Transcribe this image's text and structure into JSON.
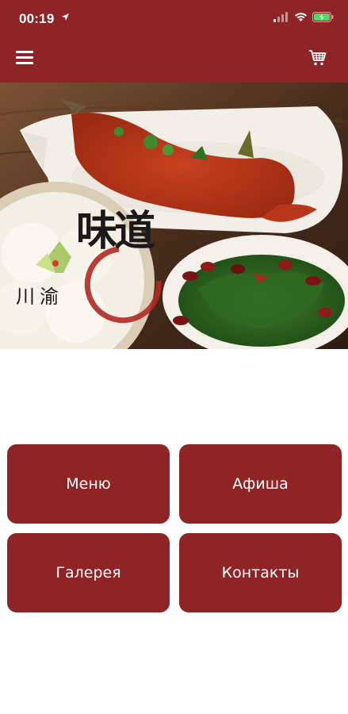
{
  "status": {
    "time": "00:19"
  },
  "appbar": {
    "menu_icon": "hamburger-menu-icon",
    "cart_icon": "shopping-cart-icon"
  },
  "hero": {
    "logo_text_main": "味道",
    "logo_text_side": "川渝"
  },
  "tiles": [
    {
      "label": "Меню"
    },
    {
      "label": "Афиша"
    },
    {
      "label": "Галерея"
    },
    {
      "label": "Контакты"
    }
  ],
  "colors": {
    "brand": "#8e2426",
    "background": "#ffffff"
  }
}
